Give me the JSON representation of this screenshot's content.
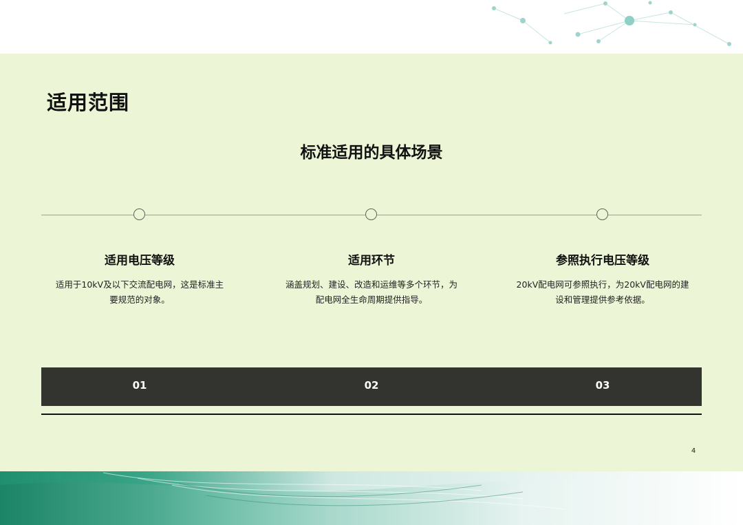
{
  "page": {
    "title": "适用范围",
    "subtitle": "标准适用的具体场景",
    "page_number": "4"
  },
  "items": [
    {
      "number": "01",
      "title": "适用电压等级",
      "desc_line1": "适用于10kV及以下交流配电网，这是标准主",
      "desc_line2": "要规范的对象。"
    },
    {
      "number": "02",
      "title": "适用环节",
      "desc_line1": "涵盖规划、建设、改造和运维等多个环节，为",
      "desc_line2": "配电网全生命周期提供指导。"
    },
    {
      "number": "03",
      "title": "参照执行电压等级",
      "desc_line1": "20kV配电网可参照执行，为20kV配电网的建",
      "desc_line2": "设和管理提供参考依据。"
    }
  ],
  "colors": {
    "panel_bg": "#ecf6d6",
    "bar_bg": "#33342f",
    "accent_green": "#2f9a78"
  }
}
